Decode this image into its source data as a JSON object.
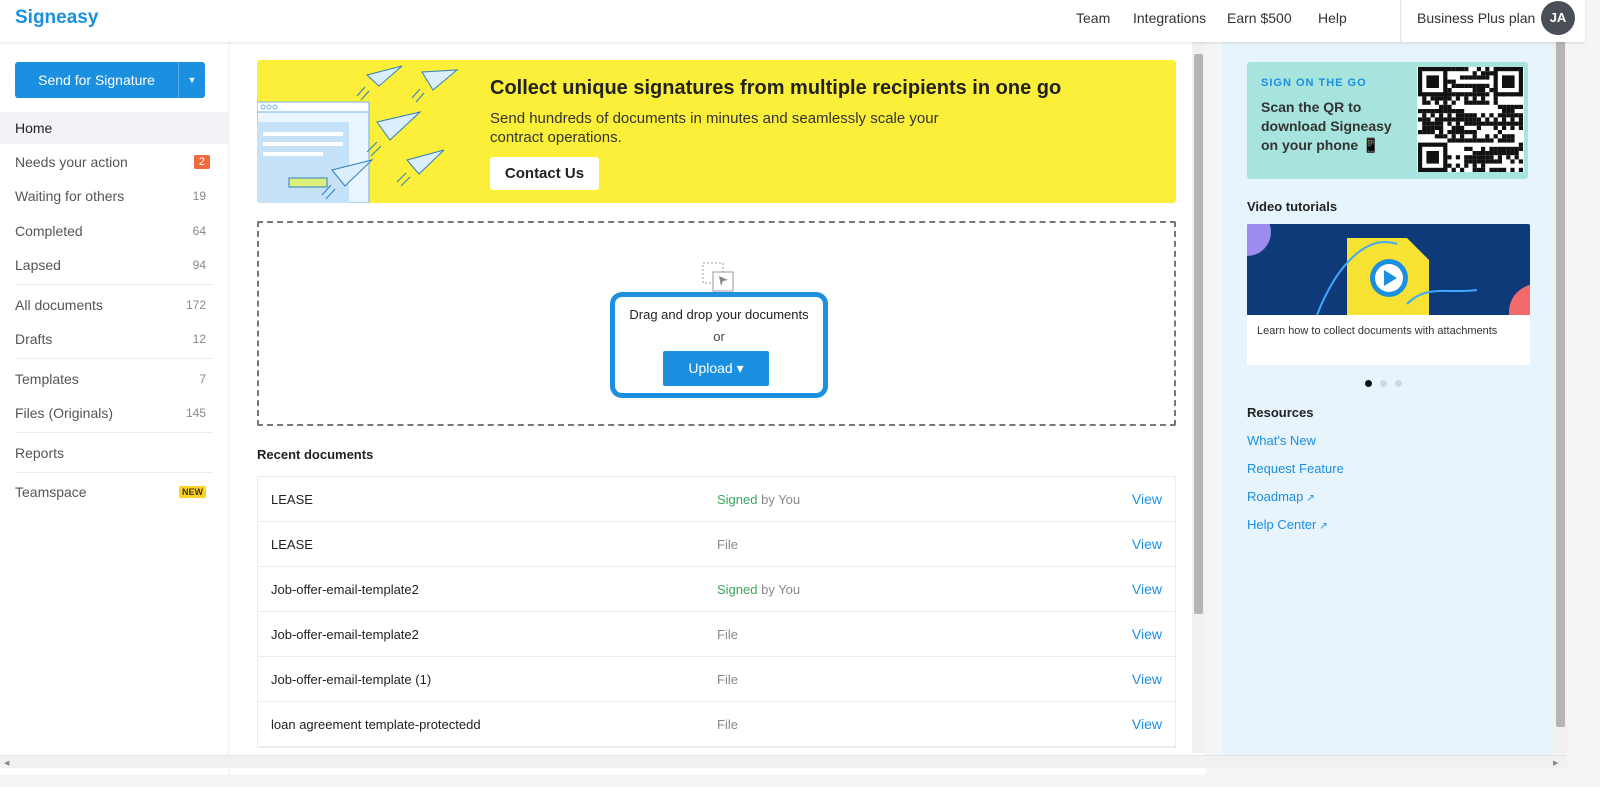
{
  "app": {
    "logo": "Signeasy"
  },
  "header": {
    "nav": [
      "Team",
      "Integrations",
      "Earn $500",
      "Help"
    ],
    "plan": "Business Plus plan",
    "avatar_initials": "JA"
  },
  "sidebar": {
    "send_label": "Send for Signature",
    "items": [
      {
        "label": "Home"
      },
      {
        "label": "Needs your action",
        "count": "2"
      },
      {
        "label": "Waiting for others",
        "count": "19"
      },
      {
        "label": "Completed",
        "count": "64"
      },
      {
        "label": "Lapsed",
        "count": "94"
      },
      {
        "label": "All documents",
        "count": "172"
      },
      {
        "label": "Drafts",
        "count": "12"
      },
      {
        "label": "Templates",
        "count": "7"
      },
      {
        "label": "Files (Originals)",
        "count": "145"
      },
      {
        "label": "Reports"
      },
      {
        "label": "Teamspace",
        "badge": "NEW"
      }
    ]
  },
  "banner": {
    "title": "Collect unique signatures from multiple recipients in one go",
    "subtitle": "Send hundreds of documents in minutes and seamlessly scale your contract operations.",
    "button": "Contact Us"
  },
  "dropzone": {
    "text": "Drag and drop your documents",
    "or": "or",
    "upload_label": "Upload ▾"
  },
  "recent": {
    "title": "Recent documents",
    "rows": [
      {
        "name": "LEASE",
        "status_strong": "Signed",
        "status_rest": " by You",
        "action": "View"
      },
      {
        "name": "LEASE",
        "status_strong": "",
        "status_rest": "File",
        "action": "View"
      },
      {
        "name": "Job-offer-email-template2",
        "status_strong": "Signed",
        "status_rest": " by You",
        "action": "View"
      },
      {
        "name": "Job-offer-email-template2",
        "status_strong": "",
        "status_rest": "File",
        "action": "View"
      },
      {
        "name": "Job-offer-email-template (1)",
        "status_strong": "",
        "status_rest": "File",
        "action": "View"
      },
      {
        "name": "loan agreement template-protectedd",
        "status_strong": "",
        "status_rest": "File",
        "action": "View"
      }
    ]
  },
  "right": {
    "qr_tag": "SIGN ON THE GO",
    "qr_text": "Scan the QR to download Signeasy on your phone",
    "qr_phone_icon": "📱",
    "video_title": "Video tutorials",
    "video_caption": "Learn how to collect documents with attachments",
    "resources_title": "Resources",
    "links": [
      {
        "label": "What's New",
        "external": false
      },
      {
        "label": "Request Feature",
        "external": false
      },
      {
        "label": "Roadmap",
        "external": true
      },
      {
        "label": "Help Center",
        "external": true
      }
    ],
    "external_glyph": "↗"
  },
  "colors": {
    "accent": "#1b8fe0",
    "banner": "#fbef3a",
    "signed": "#3aa55a",
    "qr_card": "#a6e4dd"
  },
  "icons": [
    "chevron-down-icon",
    "paper-plane-icon",
    "drop-cursor-icon",
    "play-icon",
    "qr-code-icon",
    "external-link-icon"
  ]
}
